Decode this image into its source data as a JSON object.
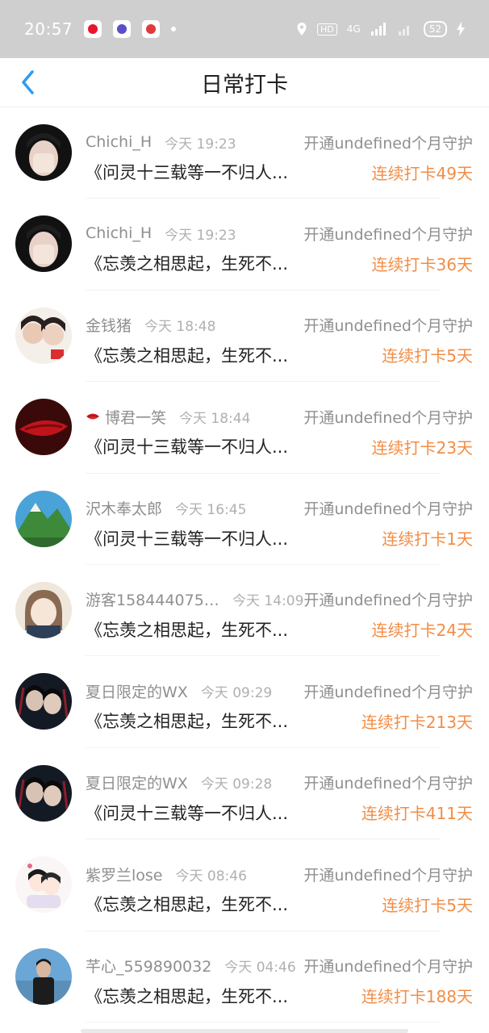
{
  "status_bar": {
    "time": "20:57",
    "hd_label": "HD",
    "network_label": "4G",
    "battery": "52"
  },
  "nav": {
    "title": "日常打卡"
  },
  "rows": [
    {
      "username": "Chichi_H",
      "time": "今天 19:23",
      "guard": "开通undefined个月守护",
      "content": "《问灵十三载等一不归人...",
      "streak": "连续打卡49天"
    },
    {
      "username": "Chichi_H",
      "time": "今天 19:23",
      "guard": "开通undefined个月守护",
      "content": "《忘羡之相思起，生死不...",
      "streak": "连续打卡36天"
    },
    {
      "username": "金钱猪",
      "time": "今天 18:48",
      "guard": "开通undefined个月守护",
      "content": "《忘羡之相思起，生死不...",
      "streak": "连续打卡5天"
    },
    {
      "username": "博君一笑",
      "time": "今天 18:44",
      "guard": "开通undefined个月守护",
      "content": "《问灵十三载等一不归人...",
      "streak": "连续打卡23天"
    },
    {
      "username": "沢木奉太郎",
      "time": "今天 16:45",
      "guard": "开通undefined个月守护",
      "content": "《问灵十三载等一不归人...",
      "streak": "连续打卡1天"
    },
    {
      "username": "游客15844407500...",
      "time": "今天 14:09",
      "guard": "开通undefined个月守护",
      "content": "《忘羡之相思起，生死不...",
      "streak": "连续打卡24天"
    },
    {
      "username": "夏日限定的WX",
      "time": "今天 09:29",
      "guard": "开通undefined个月守护",
      "content": "《忘羡之相思起，生死不...",
      "streak": "连续打卡213天"
    },
    {
      "username": "夏日限定的WX",
      "time": "今天 09:28",
      "guard": "开通undefined个月守护",
      "content": "《问灵十三载等一不归人...",
      "streak": "连续打卡411天"
    },
    {
      "username": "紫罗兰lose",
      "time": "今天 08:46",
      "guard": "开通undefined个月守护",
      "content": "《忘羡之相思起，生死不...",
      "streak": "连续打卡5天"
    },
    {
      "username": "芊心_559890032",
      "time": "今天 04:46",
      "guard": "开通undefined个月守护",
      "content": "《忘羡之相思起，生死不...",
      "streak": "连续打卡188天"
    }
  ],
  "colors": {
    "accent_blue": "#2e9bf0",
    "streak_orange": "#f28d45",
    "status_bar_bg": "#cfcfcf"
  }
}
